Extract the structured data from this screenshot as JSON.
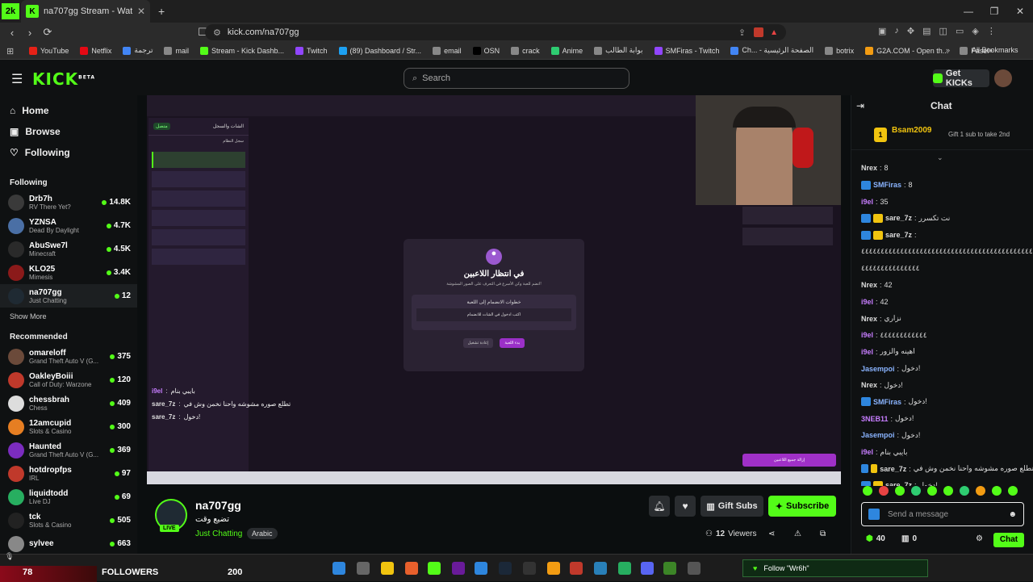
{
  "browser": {
    "tab_title": "na707gg Stream - Watch Live on",
    "url": "kick.com/na707gg",
    "bookmarks": [
      "YouTube",
      "Netflix",
      "ترجمة",
      "mail",
      "Stream - Kick Dashb...",
      "Twitch",
      "(89) Dashboard / Str...",
      "email",
      "OSN",
      "crack",
      "Anime",
      "بوابة الطالب",
      "SMFiras - Twitch",
      "Ch... - الصفحة الرئيسية",
      "botrix",
      "G2A.COM - Open th...",
      "Fasel+"
    ],
    "all_bookmarks": "All Bookmarks"
  },
  "header": {
    "logo": "KICK",
    "logo_beta": "BETA",
    "search_placeholder": "Search",
    "get_kicks": "Get KICKs"
  },
  "sidebar": {
    "nav": [
      "Home",
      "Browse",
      "Following"
    ],
    "following_title": "Following",
    "following": [
      {
        "name": "Drb7h",
        "sub": "RV There Yet?",
        "viewers": "14.8K"
      },
      {
        "name": "YZNSA",
        "sub": "Dead By Daylight",
        "viewers": "4.7K"
      },
      {
        "name": "AbuSwe7l",
        "sub": "Minecraft",
        "viewers": "4.5K"
      },
      {
        "name": "KLO25",
        "sub": "Mimesis",
        "viewers": "3.4K"
      },
      {
        "name": "na707gg",
        "sub": "Just Chatting",
        "viewers": "12"
      }
    ],
    "show_more": "Show More",
    "recommended_title": "Recommended",
    "recommended": [
      {
        "name": "omareloff",
        "sub": "Grand Theft Auto V (G...",
        "viewers": "375"
      },
      {
        "name": "OakleyBoiii",
        "sub": "Call of Duty: Warzone",
        "viewers": "120"
      },
      {
        "name": "chessbrah",
        "sub": "Chess",
        "viewers": "409"
      },
      {
        "name": "12amcupid",
        "sub": "Slots & Casino",
        "viewers": "300"
      },
      {
        "name": "Haunted",
        "sub": "Grand Theft Auto V (G...",
        "viewers": "369"
      },
      {
        "name": "hotdropfps",
        "sub": "IRL",
        "viewers": "97"
      },
      {
        "name": "liquidtodd",
        "sub": "Live DJ",
        "viewers": "69"
      },
      {
        "name": "tck",
        "sub": "Slots & Casino",
        "viewers": "505"
      },
      {
        "name": "sylvee",
        "sub": "",
        "viewers": "663"
      }
    ]
  },
  "video": {
    "app_panel_title": "الشات والسجل",
    "app_log_title": "سجل النظام",
    "app_status": "متصل",
    "modal_title": "في انتظار اللاعبين",
    "modal_sub": "انضم للعبة وكن الأسرع في التعرف على الصور المشوشة!",
    "modal_steps_title": "خطوات الانضمام إلى اللعبة",
    "modal_step": "اكتب  ادخول  في الشات للانضمام",
    "modal_btn_restart": "إعادة تشغيل",
    "modal_btn_start": "بدء اللعبة",
    "overlay_chat": [
      {
        "user": "i9el",
        "text": "بايبي بنام"
      },
      {
        "user": "sare_7z",
        "text": "تطلع صوره مشوشه واحنا نخمن وش في"
      },
      {
        "user": "sare_7z",
        "text": "دخول!"
      }
    ],
    "remove_all_btn": "إزالة جميع اللاعبين"
  },
  "stream": {
    "channel": "na707gg",
    "live": "LIVE",
    "title": "تضيع وقت",
    "category": "Just Chatting",
    "tag": "Arabic",
    "gift_subs": "Gift Subs",
    "subscribe": "Subscribe",
    "viewers": "12",
    "viewers_label": "Viewers"
  },
  "chat": {
    "title": "Chat",
    "pinned_user": "Bsam2009",
    "pinned_count": "1",
    "pinned_text": "Gift 1 sub to take 2nd",
    "messages": [
      {
        "user": "Nrex",
        "text": "8",
        "color": "#dddddd"
      },
      {
        "user": "SMFiras",
        "text": "8",
        "color": "#8ab4ff"
      },
      {
        "user": "i9el",
        "text": "35",
        "color": "#c77dff"
      },
      {
        "user": "sare_7z",
        "text": "نت تكسرر",
        "color": "#dddddd"
      },
      {
        "user": "sare_7z",
        "text": "",
        "color": "#dddddd"
      },
      {
        "user": "",
        "text": "٤٤٤٤٤٤٤٤٤٤٤٤٤٤٤٤٤٤٤٤٤٤٤٤٤٤٤٤٤٤٤٤٤٤٤٤٤٤٤٤٤٤٤٤٤٤٤٤٤٤٤٤٤٤٤٤٤٤٤٤٤",
        "color": "#dddddd"
      },
      {
        "user": "",
        "text": "٤٤٤٤٤٤٤٤٤٤٤٤٤٤٤",
        "color": "#dddddd"
      },
      {
        "user": "Nrex",
        "text": "42",
        "color": "#dddddd"
      },
      {
        "user": "i9el",
        "text": "42",
        "color": "#c77dff"
      },
      {
        "user": "Nrex",
        "text": "نزاري",
        "color": "#dddddd"
      },
      {
        "user": "i9el",
        "text": "٤٤٤٤٤٤٤٤٤٤٤٤",
        "color": "#c77dff"
      },
      {
        "user": "i9el",
        "text": "اهينه والزور",
        "color": "#c77dff"
      },
      {
        "user": "Jasempoi",
        "text": "دخول!",
        "color": "#8ab4ff"
      },
      {
        "user": "Nrex",
        "text": "دخول!",
        "color": "#dddddd"
      },
      {
        "user": "SMFiras",
        "text": "دخول!",
        "color": "#8ab4ff"
      },
      {
        "user": "3NEB11",
        "text": "دخول!",
        "color": "#c77dff"
      },
      {
        "user": "Jasempoi",
        "text": "دخول!",
        "color": "#8ab4ff"
      },
      {
        "user": "i9el",
        "text": "بايبي بنام",
        "color": "#c77dff"
      },
      {
        "user": "sare_7z",
        "text": "تطلع صوره مشوشه واحنا نخمن وش في",
        "color": "#dddddd"
      },
      {
        "user": "sare_7z",
        "text": "دخول!",
        "color": "#dddddd"
      }
    ],
    "input_placeholder": "Send a message",
    "points": "40",
    "gifts": "0",
    "send": "Chat"
  },
  "taskbar": {
    "followers_count": "78",
    "followers_label": "FOLLOWERS",
    "count_right": "200",
    "follow_alert": "Follow  \"Wr6h\""
  },
  "colors": {
    "accent": "#53fc18",
    "bg": "#0b0e0f",
    "panel": "#0f1112"
  }
}
